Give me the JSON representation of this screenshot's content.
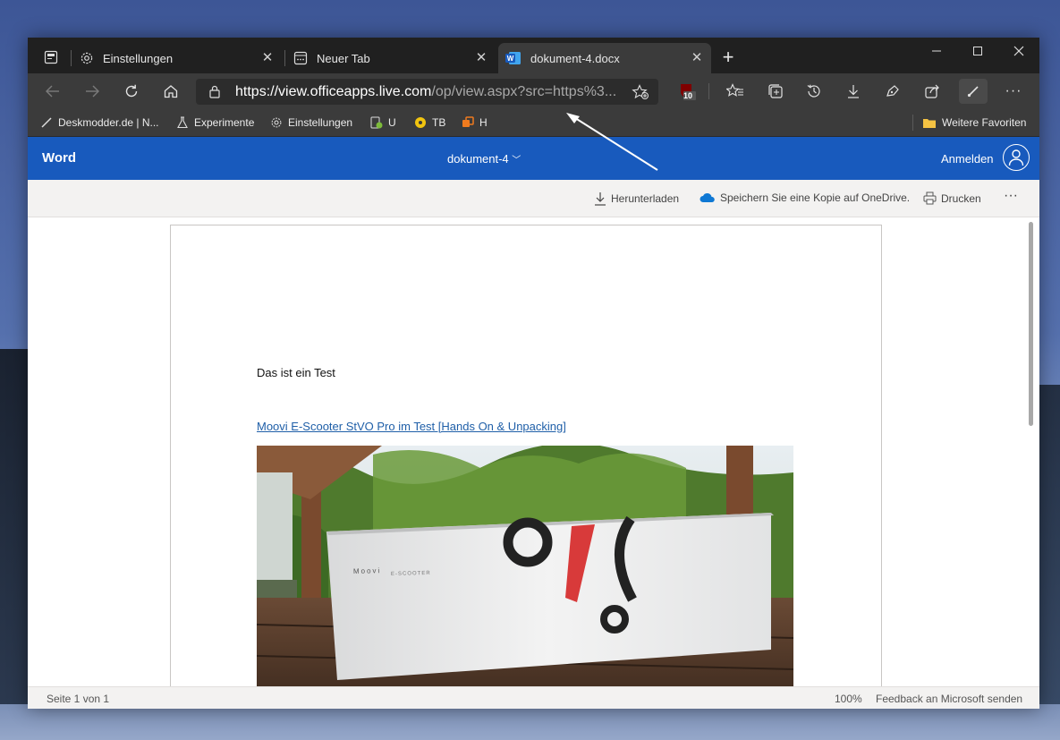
{
  "browser": {
    "tabs": [
      {
        "label": "Einstellungen",
        "icon": "gear-icon",
        "active": false
      },
      {
        "label": "Neuer Tab",
        "icon": "new-tab-icon",
        "active": false
      },
      {
        "label": "dokument-4.docx",
        "icon": "word-icon",
        "active": true
      }
    ],
    "address": {
      "host_part": "https://view.officeapps.live.com",
      "path_part": "/op/view.aspx?src=https%3..."
    },
    "extension_badge": "10",
    "favorites": [
      {
        "label": "Deskmodder.de | N...",
        "icon": "brush-icon"
      },
      {
        "label": "Experimente",
        "icon": "flask-icon"
      },
      {
        "label": "Einstellungen",
        "icon": "gear-icon"
      },
      {
        "label": "U",
        "icon": "app-icon"
      },
      {
        "label": "TB",
        "icon": "coin-icon"
      },
      {
        "label": "H",
        "icon": "orange-app-icon"
      }
    ],
    "other_favorites": "Weitere Favoriten"
  },
  "word": {
    "app_name": "Word",
    "doc_title": "dokument-4",
    "signin": "Anmelden",
    "commands": {
      "download": "Herunterladen",
      "save_copy": "Speichern Sie eine Kopie auf OneDrive.",
      "print": "Drucken"
    },
    "document": {
      "paragraph1": "Das ist ein Test",
      "link": "Moovi E-Scooter StVO Pro im Test [Hands On & Unpacking]",
      "image_brand_text": "Moovi",
      "image_sub_text": "E-SCOOTER"
    },
    "status": {
      "page": "Seite 1 von 1",
      "zoom": "100%",
      "feedback": "Feedback an Microsoft senden"
    }
  },
  "colors": {
    "word_blue": "#185abd",
    "browser_dark": "#3b3b3b",
    "tab_strip": "#202020",
    "link": "#1f5fa8"
  }
}
